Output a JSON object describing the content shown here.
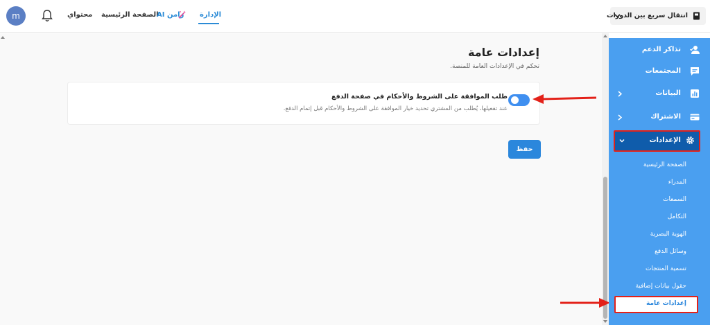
{
  "topbar": {
    "avatar_letter": "m",
    "nav": {
      "content": "محتواي",
      "home": "الصفحة الرئيسية",
      "ai": "زامن AI",
      "admin": "الإدارة"
    },
    "course_switcher": "انتقال سريع بين الدورات"
  },
  "main": {
    "title": "إعدادات عامة",
    "subtitle": "تحكم في الإعدادات العامة للمنصة.",
    "setting": {
      "title": "طلب الموافقة على الشروط والأحكام في صفحة الدفع",
      "description": "عند تفعيلها، يُطلب من المشتري تحديد خيار الموافقة على الشروط والأحكام قبل إتمام الدفع.",
      "enabled": true
    },
    "save_label": "حفظ"
  },
  "sidebar": {
    "items": [
      {
        "label": "تذاكر الدعم",
        "icon": "user-check-icon"
      },
      {
        "label": "المجتمعات",
        "icon": "chat-icon"
      },
      {
        "label": "البيانات",
        "icon": "chart-icon"
      },
      {
        "label": "الاشتراك",
        "icon": "card-icon"
      },
      {
        "label": "الإعدادات",
        "icon": "gear-icon"
      }
    ],
    "sub_items": [
      "الصفحة الرئيسية",
      "المدراء",
      "السمعات",
      "التكامل",
      "الهوية البصرية",
      "وسائل الدفع",
      "تسمية المنتجات",
      "حقول بيانات إضافية"
    ],
    "current_sub": "إعدادات عامة"
  },
  "colors": {
    "accent": "#2b87dc",
    "sidebar": "#4a9ff0",
    "sidebar_active": "#0f5cab",
    "annotation": "#e32119"
  }
}
